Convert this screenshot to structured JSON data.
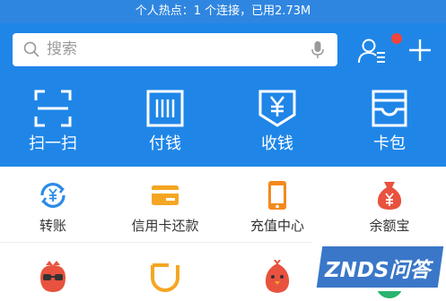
{
  "status_bar": {
    "text": "个人热点：1 个连接，已用2.73M"
  },
  "search": {
    "placeholder": "搜索"
  },
  "top_actions": [
    {
      "label": "扫一扫",
      "icon": "scan-icon"
    },
    {
      "label": "付钱",
      "icon": "barcode-icon"
    },
    {
      "label": "收钱",
      "icon": "yuan-receive-icon"
    },
    {
      "label": "卡包",
      "icon": "card-wallet-icon"
    }
  ],
  "services_row1": [
    {
      "label": "转账",
      "icon": "transfer-icon"
    },
    {
      "label": "信用卡还款",
      "icon": "credit-card-icon"
    },
    {
      "label": "充值中心",
      "icon": "phone-recharge-icon"
    },
    {
      "label": "余额宝",
      "icon": "money-bag-icon"
    }
  ],
  "services_row2": [
    {
      "icon": "glasses-character-icon"
    },
    {
      "icon": "didi-icon"
    },
    {
      "icon": "chick-icon"
    },
    {
      "icon": "green-app-icon"
    }
  ],
  "watermark": {
    "text": "ZNDS问答"
  },
  "colors": {
    "header": "#1f86e8",
    "status_bar": "#2f86e0",
    "badge": "#f0443c",
    "watermark": "#3a77c9"
  }
}
